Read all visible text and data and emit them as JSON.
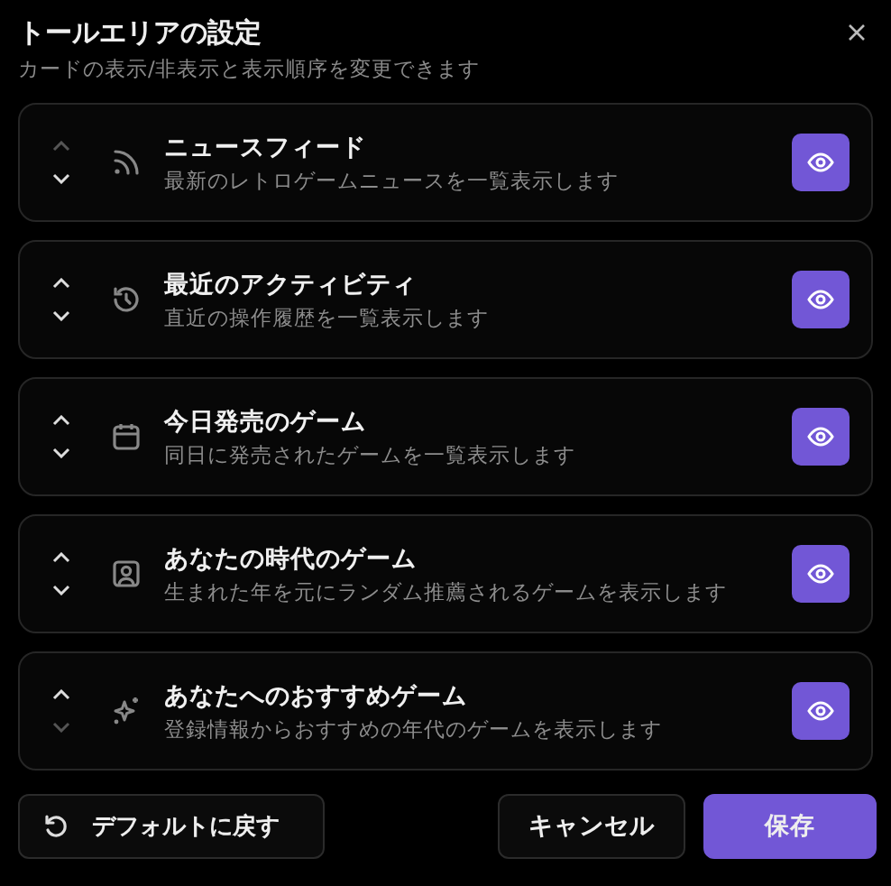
{
  "dialog": {
    "title": "トールエリアの設定",
    "subtitle": "カードの表示/非表示と表示順序を変更できます"
  },
  "cards": [
    {
      "kind": "feed",
      "title": "ニュースフィード",
      "description": "最新のレトロゲームニュースを一覧表示します",
      "up_disabled": true,
      "down_disabled": false,
      "visible": true
    },
    {
      "kind": "history",
      "title": "最近のアクティビティ",
      "description": "直近の操作履歴を一覧表示します",
      "up_disabled": false,
      "down_disabled": false,
      "visible": true
    },
    {
      "kind": "calendar",
      "title": "今日発売のゲーム",
      "description": "同日に発売されたゲームを一覧表示します",
      "up_disabled": false,
      "down_disabled": false,
      "visible": true
    },
    {
      "kind": "profile",
      "title": "あなたの時代のゲーム",
      "description": "生まれた年を元にランダム推薦されるゲームを表示します",
      "up_disabled": false,
      "down_disabled": false,
      "visible": true
    },
    {
      "kind": "recommend",
      "title": "あなたへのおすすめゲーム",
      "description": "登録情報からおすすめの年代のゲームを表示します",
      "up_disabled": false,
      "down_disabled": true,
      "visible": true
    }
  ],
  "buttons": {
    "reset": "デフォルトに戻す",
    "cancel": "キャンセル",
    "save": "保存"
  }
}
